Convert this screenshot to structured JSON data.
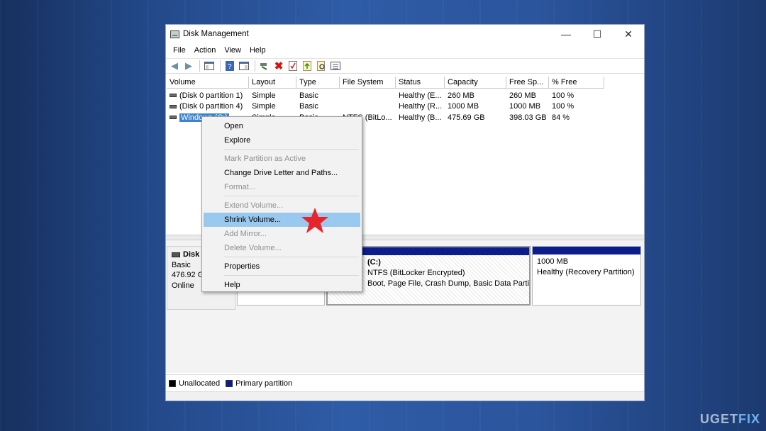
{
  "window": {
    "title": "Disk Management",
    "controls": {
      "minimize": "—",
      "maximize": "☐",
      "close": "✕"
    }
  },
  "menubar": [
    "File",
    "Action",
    "View",
    "Help"
  ],
  "toolbar": {
    "icons": [
      "back-icon",
      "forward-icon",
      "console-tree-icon",
      "help-icon",
      "show-hide-icon",
      "connect-icon",
      "delete-icon",
      "properties-icon",
      "export-icon",
      "search-icon",
      "list-view-icon"
    ]
  },
  "volume_table": {
    "columns": [
      "Volume",
      "Layout",
      "Type",
      "File System",
      "Status",
      "Capacity",
      "Free Sp...",
      "% Free"
    ],
    "rows": [
      [
        "(Disk 0 partition 1)",
        "Simple",
        "Basic",
        "",
        "Healthy (E...",
        "260 MB",
        "260 MB",
        "100 %"
      ],
      [
        "(Disk 0 partition 4)",
        "Simple",
        "Basic",
        "",
        "Healthy (R...",
        "1000 MB",
        "1000 MB",
        "100 %"
      ],
      [
        "Windows (C:)",
        "Simple",
        "Basic",
        "NTFS (BitLo...",
        "Healthy (B...",
        "475.69 GB",
        "398.03 GB",
        "84 %"
      ]
    ],
    "selected_row": 2
  },
  "disk_panel": {
    "disk_name": "Disk",
    "type": "Basic",
    "size": "476.92 G",
    "state": "Online",
    "partitions": [
      {
        "title": "",
        "line1": "",
        "line2": ""
      },
      {
        "title": "(C:)",
        "line1": "NTFS (BitLocker Encrypted)",
        "line2": "Boot, Page File, Crash Dump, Basic Data Partition)"
      },
      {
        "title": "",
        "line1": "1000 MB",
        "line2": "Healthy (Recovery Partition)"
      }
    ]
  },
  "legend": [
    {
      "label": "Unallocated",
      "color": "#000000"
    },
    {
      "label": "Primary partition",
      "color": "#0b1c8c"
    }
  ],
  "context_menu": {
    "items": [
      {
        "label": "Open",
        "enabled": true
      },
      {
        "label": "Explore",
        "enabled": true
      },
      {
        "label": "Mark Partition as Active",
        "enabled": false
      },
      {
        "label": "Change Drive Letter and Paths...",
        "enabled": true
      },
      {
        "label": "Format...",
        "enabled": false
      },
      {
        "label": "Extend Volume...",
        "enabled": false
      },
      {
        "label": "Shrink Volume...",
        "enabled": true,
        "highlighted": true
      },
      {
        "label": "Add Mirror...",
        "enabled": false
      },
      {
        "label": "Delete Volume...",
        "enabled": false
      },
      {
        "label": "Properties",
        "enabled": true
      },
      {
        "label": "Help",
        "enabled": true
      }
    ]
  },
  "watermark": {
    "part1": "UG",
    "part2": "ET",
    "part3": "FIX"
  },
  "colors": {
    "selection": "#3b84d4",
    "menu_highlight": "#99c9ef",
    "star": "#e8232b",
    "primary_partition": "#0b1c8c"
  }
}
